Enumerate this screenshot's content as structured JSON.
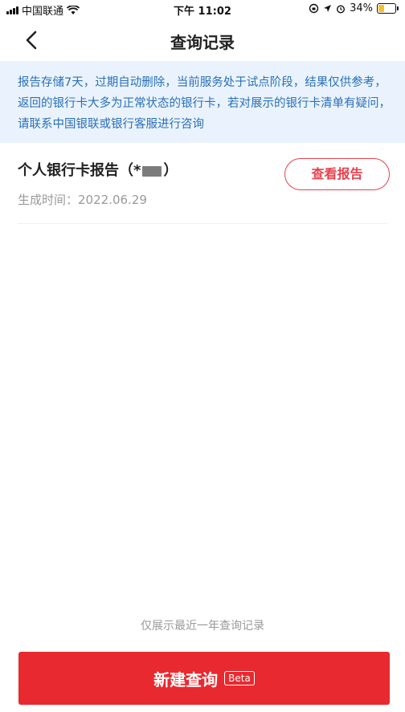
{
  "status_bar": {
    "carrier": "中国联通",
    "time": "下午 11:02",
    "battery": "34%",
    "battery_level": 0.34
  },
  "nav": {
    "title": "查询记录",
    "back_icon": "chevron-left-icon"
  },
  "notice": {
    "text": "报告存储7天，过期自动删除，当前服务处于试点阶段，结果仅供参考，返回的银行卡大多为正常状态的银行卡，若对展示的银行卡清单有疑问，请联系中国银联或银行客服进行咨询"
  },
  "records": [
    {
      "title_prefix": "个人银行卡报告（*",
      "title_suffix": "）",
      "time_label": "生成时间：",
      "time_value": "2022.06.29",
      "action_label": "查看报告"
    }
  ],
  "footer": {
    "note": "仅展示最近一年查询记录",
    "button_label": "新建查询",
    "badge": "Beta"
  },
  "colors": {
    "accent": "#e8292f",
    "notice_bg": "#eaf3fd",
    "notice_text": "#2a6fb8"
  }
}
